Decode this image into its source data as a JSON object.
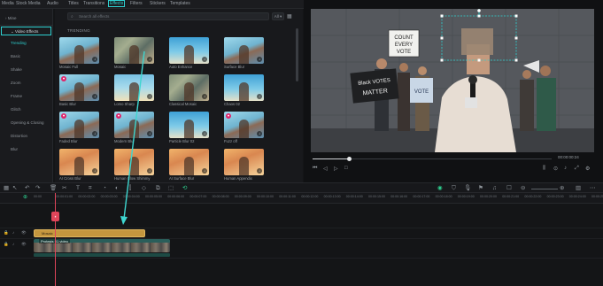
{
  "top_tabs": [
    "Media",
    "Stock Media",
    "Audio",
    "Titles",
    "Transitions",
    "Effects",
    "Filters",
    "Stickers",
    "Templates"
  ],
  "active_tab": "Effects",
  "sidebar": {
    "items": [
      "Mine",
      "Video Effects",
      "Trending",
      "Basic",
      "Shake",
      "Zoom",
      "Frame",
      "Glitch",
      "Opening & Closing",
      "Distortion",
      "Blur"
    ],
    "active_parent": "Video Effects",
    "active_child": "Trending"
  },
  "search": {
    "placeholder": "Search all effects",
    "filter_label": "All"
  },
  "section_title": "TRENDING",
  "effects": [
    {
      "label": "Mosaic Full",
      "theme": "blur",
      "heart": false
    },
    {
      "label": "Mosaic",
      "theme": "mosaic",
      "heart": false
    },
    {
      "label": "Auto Enhance",
      "theme": "sky",
      "heart": false
    },
    {
      "label": "Surface Blur",
      "theme": "blur",
      "heart": false
    },
    {
      "label": "Basic Blur",
      "theme": "blur",
      "heart": true
    },
    {
      "label": "Lomo Sharp",
      "theme": "lomo",
      "heart": false
    },
    {
      "label": "Classical Mosaic",
      "theme": "mosaic",
      "heart": false
    },
    {
      "label": "Chaos 02",
      "theme": "sky",
      "heart": false
    },
    {
      "label": "Faded Blur",
      "theme": "blur",
      "heart": true
    },
    {
      "label": "Modern Blur",
      "theme": "blur",
      "heart": true
    },
    {
      "label": "Particle Blur 02",
      "theme": "sky",
      "heart": false
    },
    {
      "label": "Fuzz off",
      "theme": "blur",
      "heart": true
    },
    {
      "label": "AI Cross Blur",
      "theme": "portrait",
      "heart": false
    },
    {
      "label": "Human Glow Shimmy",
      "theme": "portrait",
      "heart": false
    },
    {
      "label": "AI Surface Blur",
      "theme": "portrait",
      "heart": false
    },
    {
      "label": "Human Appendix",
      "theme": "portrait",
      "heart": false
    }
  ],
  "preview": {
    "time": "00:00:00:24",
    "progress": 0.15,
    "signs": [
      "COUNT EVERY VOTE",
      "Black VOTES MATTER",
      "VOTE"
    ]
  },
  "ruler_ticks": [
    "00:00",
    "00:00:01:00",
    "00:00:02:00",
    "00:00:03:00",
    "00:00:04:00",
    "00:00:05:00",
    "00:00:06:00",
    "00:00:07:00",
    "00:00:08:00",
    "00:00:09:00",
    "00:00:10:00",
    "00:00:11:00",
    "00:00:12:00",
    "00:00:13:00",
    "00:00:14:00",
    "00:00:15:00",
    "00:00:16:00",
    "00:00:17:00",
    "00:00:18:00",
    "00:00:19:00",
    "00:00:20:00",
    "00:00:21:00",
    "00:00:22:00",
    "00:00:23:00",
    "00:00:24:00",
    "00:00:25:00"
  ],
  "clips": {
    "title_label": "Mosaic",
    "video_label": "Protests 01 video"
  },
  "colors": {
    "accent": "#2ed1d1",
    "playhead": "#e0455a",
    "title_clip": "#c4963e",
    "video_clip": "#2a5e5a"
  }
}
